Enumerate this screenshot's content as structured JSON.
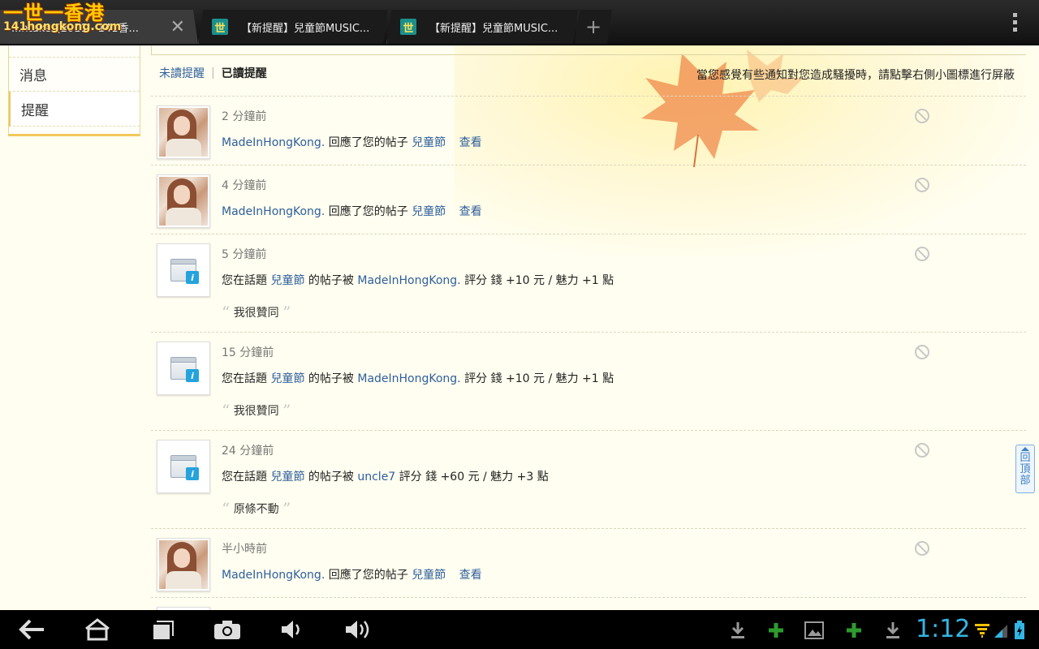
{
  "browser": {
    "logo": {
      "chinese": "一世一香港",
      "domain": "141hongkong.com"
    },
    "tabs": [
      {
        "title": "...ntakes(2011 - 141香...",
        "active": true
      },
      {
        "title": "【新提醒】兒童節MUSIC...",
        "active": false
      },
      {
        "title": "【新提醒】兒童節MUSIC...",
        "active": false
      }
    ],
    "new_tab_label": "+",
    "close_label": "✕"
  },
  "sidebar": {
    "items": [
      {
        "label": "消息",
        "active": false
      },
      {
        "label": "提醒",
        "active": true
      }
    ]
  },
  "subtabs": {
    "unread": "未讀提醒",
    "separator": "|",
    "read": "已讀提醒"
  },
  "hint": "當您感覺有些通知對您造成騷擾時，請點擊右側小圖標進行屏蔽",
  "notices": [
    {
      "time": "2 分鐘前",
      "user": "MadeInHongKong.",
      "action": "回應了您的帖子",
      "thread": "兒童節",
      "view": "查看"
    },
    {
      "time": "4 分鐘前",
      "user": "MadeInHongKong.",
      "action": "回應了您的帖子",
      "thread": "兒童節",
      "view": "查看"
    },
    {
      "time": "5 分鐘前",
      "prefix": "您在話題",
      "thread": "兒童節",
      "middle": "的帖子被",
      "user": "MadeInHongKong.",
      "rating": "評分 錢 +10 元 / 魅力 +1 點",
      "quote": "我很贊同"
    },
    {
      "time": "15 分鐘前",
      "prefix": "您在話題",
      "thread": "兒童節",
      "middle": "的帖子被",
      "user": "MadeInHongKong.",
      "rating": "評分 錢 +10 元 / 魅力 +1 點",
      "quote": "我很贊同"
    },
    {
      "time": "24 分鐘前",
      "prefix": "您在話題",
      "thread": "兒童節",
      "middle": "的帖子被",
      "user": "uncle7",
      "rating": "評分 錢 +60 元 / 魅力 +3 點",
      "quote": "原條不動"
    },
    {
      "time": "半小時前",
      "user": "MadeInHongKong.",
      "action": "回應了您的帖子",
      "thread": "兒童節",
      "view": "查看"
    }
  ],
  "back_to_top": "回頂部",
  "system_bar": {
    "clock": "1:12",
    "icons": [
      "back-icon",
      "home-icon",
      "recent-apps-icon",
      "screenshot-icon",
      "volume-down-icon",
      "volume-up-icon",
      "download-icon",
      "plus-icon",
      "image-icon",
      "plus-icon",
      "download-icon",
      "wifi-icon",
      "signal-icon",
      "battery-icon"
    ],
    "colors": {
      "clock": "#33b5e5",
      "plus": "#2e9b2e"
    }
  }
}
